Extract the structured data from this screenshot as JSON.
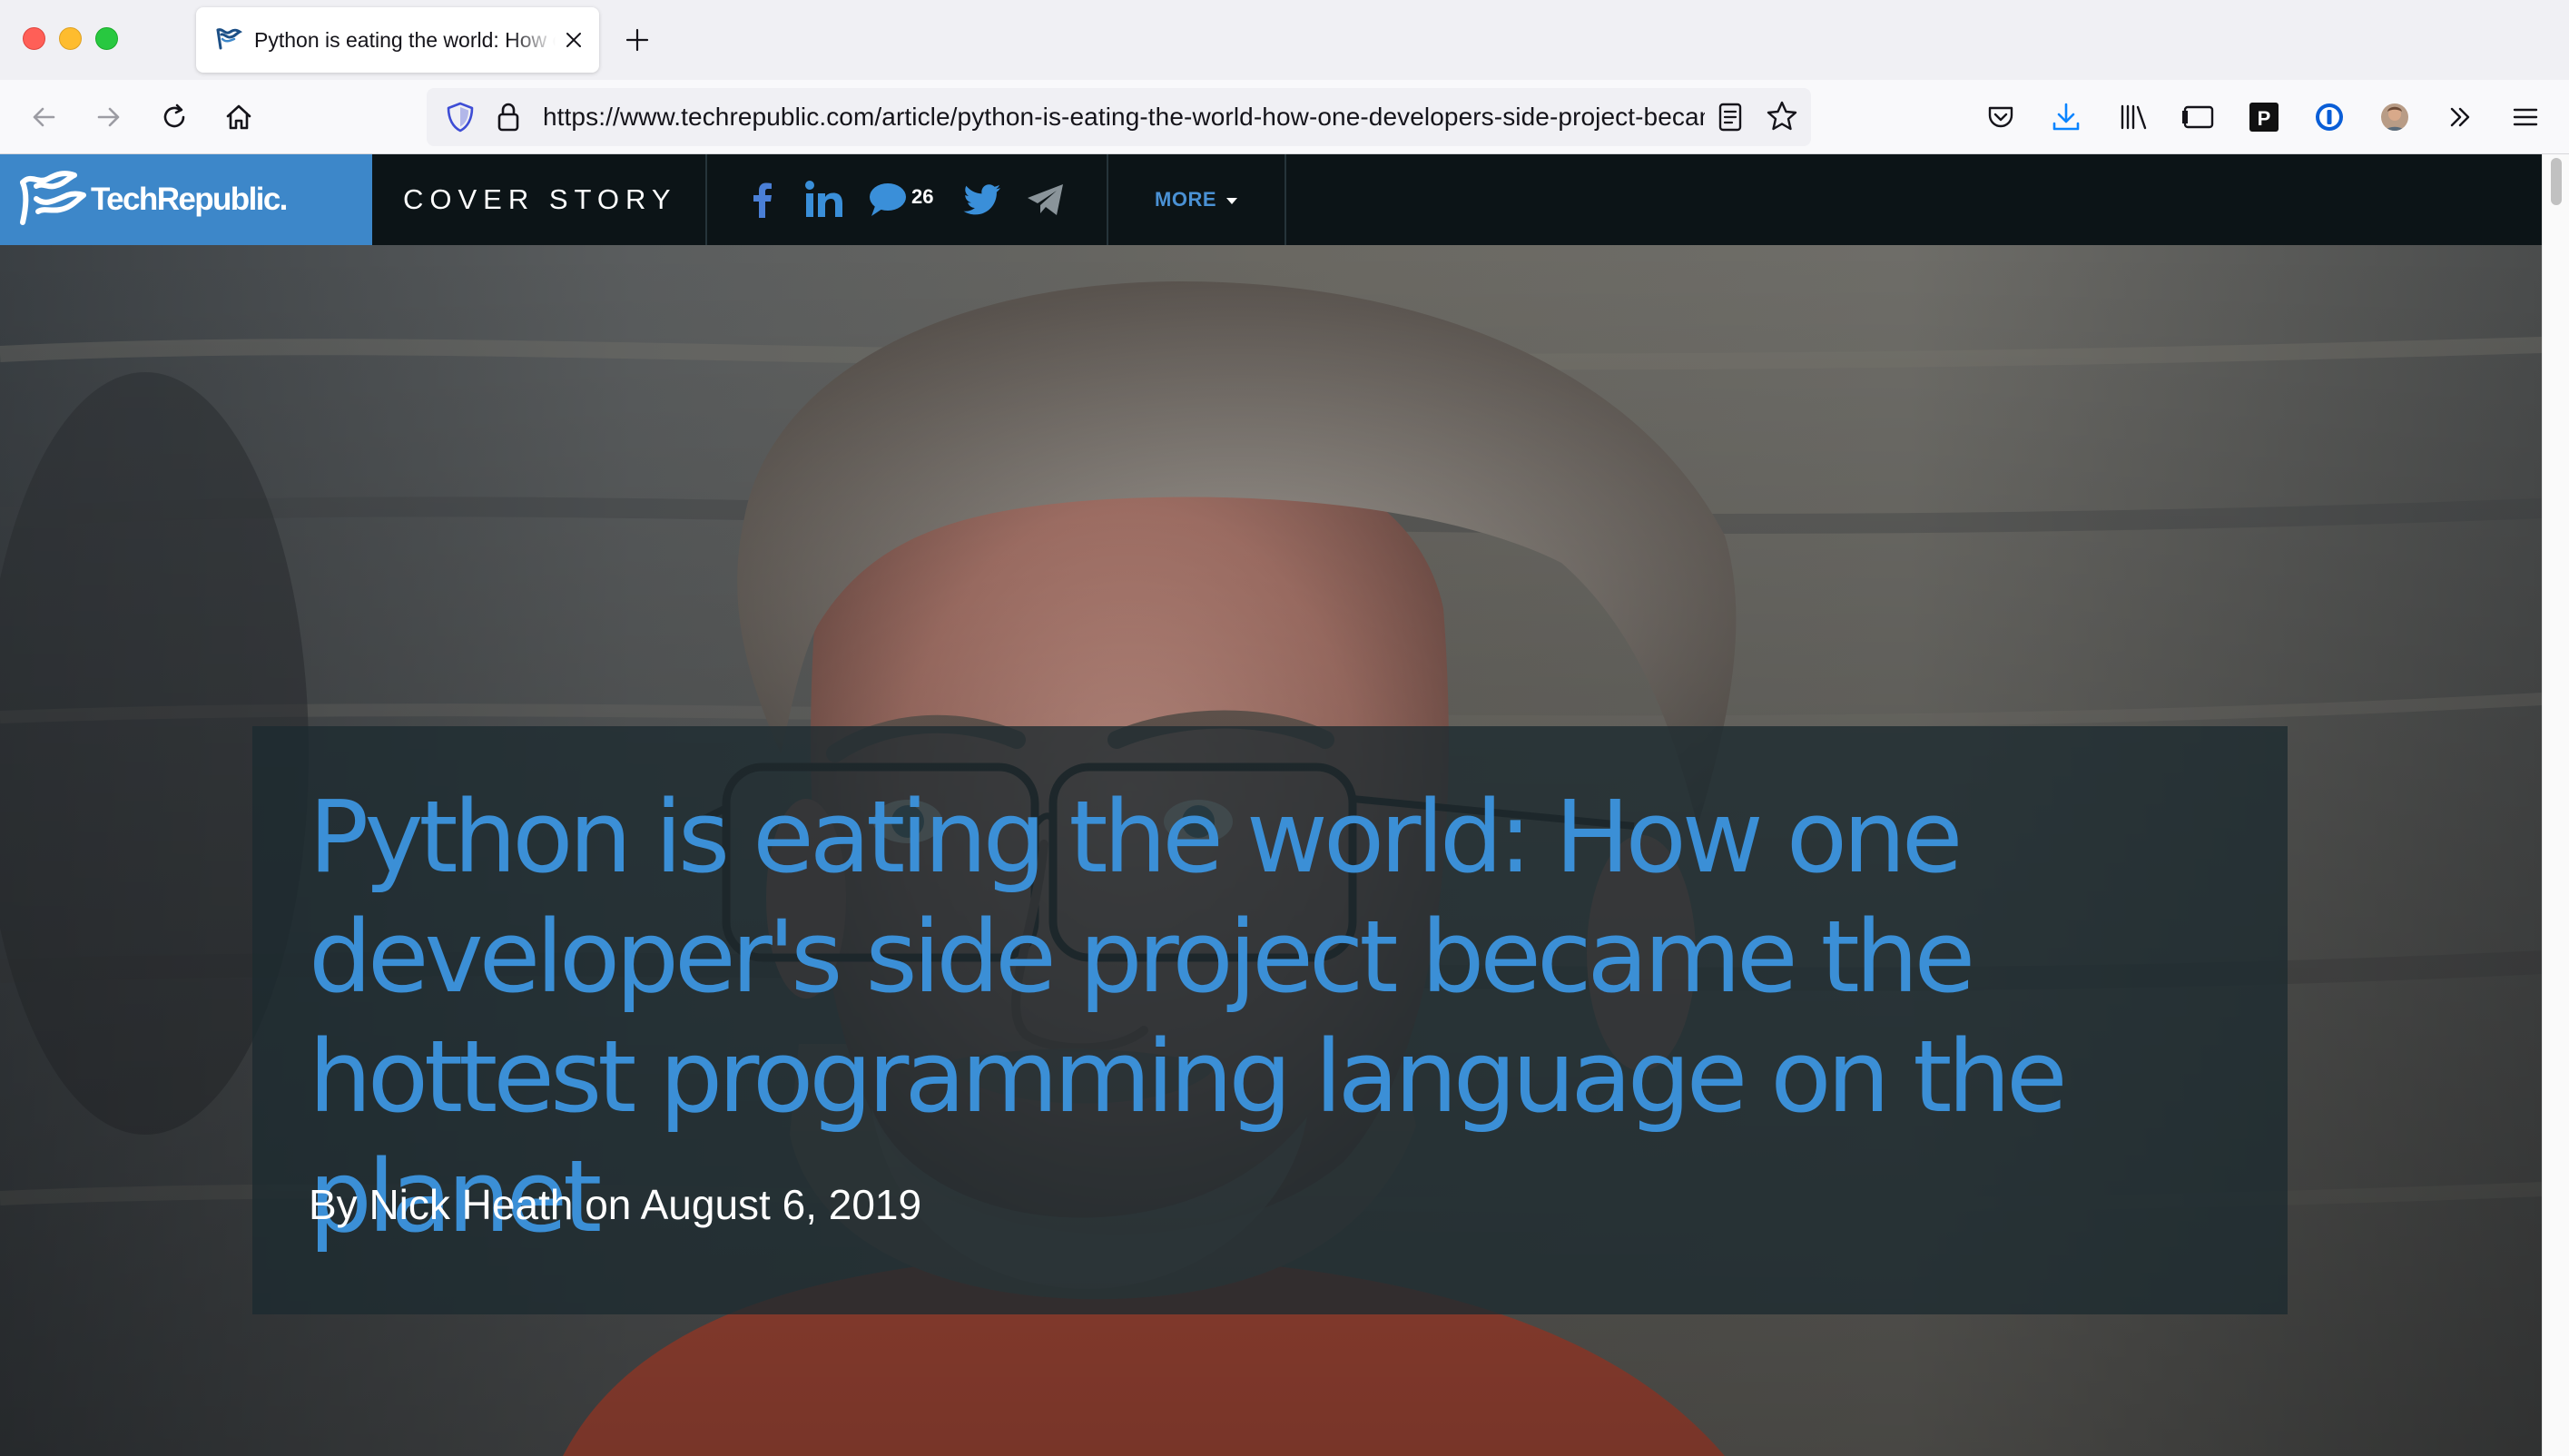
{
  "browser": {
    "tab": {
      "title": "Python is eating the world: How one developer's side project became the hottest programming language on the planet",
      "favicon": "techrepublic-favicon"
    },
    "url": {
      "full": "https://www.techrepublic.com/article/python-is-eating-the-world-how-one-developers-side-project-became-the-hottest-programming-language-on-the-planet/"
    },
    "toolbar_icons": [
      "back-icon",
      "forward-icon",
      "reload-icon",
      "home-icon",
      "tracking-shield-icon",
      "lock-icon",
      "reader-view-icon",
      "bookmark-star-icon",
      "pocket-icon",
      "downloads-icon",
      "library-icon",
      "sidebar-icon",
      "p-extension-icon",
      "password-manager-icon",
      "account-avatar",
      "overflow-icon",
      "menu-icon"
    ]
  },
  "site": {
    "logo_text": "TechRepublic.",
    "section_label": "COVER STORY",
    "comment_count": "26",
    "more_label": "MORE",
    "share_icons": [
      "facebook-icon",
      "linkedin-icon",
      "comment-icon",
      "twitter-icon",
      "telegram-icon"
    ]
  },
  "article": {
    "headline": "Python is eating the world: How one developer's side project became the hottest programming language on the planet",
    "byline": "By Nick Heath on August 6, 2019"
  },
  "colors": {
    "brand_blue": "#3d87c9",
    "header_dark": "#0c1417",
    "headline_blue": "#3b8fd6",
    "more_blue": "#4a91d4"
  }
}
